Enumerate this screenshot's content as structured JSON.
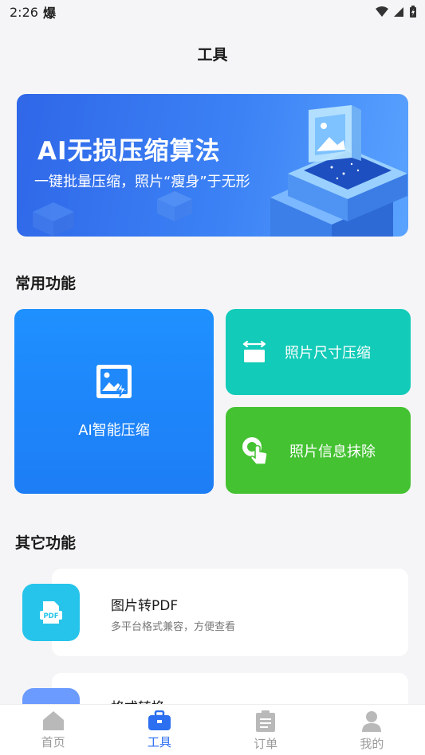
{
  "status": {
    "time": "2:26",
    "indicator": "爆"
  },
  "header": {
    "title": "工具"
  },
  "banner": {
    "title": "AI无损压缩算法",
    "subtitle": "一键批量压缩，照片“瘦身”于无形"
  },
  "sections": {
    "common": "常用功能",
    "other": "其它功能"
  },
  "cards": {
    "ai": {
      "label": "AI智能压缩",
      "icon": "image-bolt-icon",
      "color": "#1f8bff"
    },
    "resize": {
      "label": "照片尺寸压缩",
      "icon": "resize-icon",
      "color": "#12cbb8"
    },
    "erase": {
      "label": "照片信息抹除",
      "icon": "touch-erase-icon",
      "color": "#44c232"
    }
  },
  "list": [
    {
      "title": "图片转PDF",
      "desc": "多平台格式兼容，方便查看",
      "icon": "pdf-icon",
      "color": "#26c4ea"
    },
    {
      "title": "格式转换",
      "desc": "",
      "icon": "convert-icon",
      "color": "#6c9bff"
    }
  ],
  "tabs": [
    {
      "label": "首页",
      "icon": "home-icon"
    },
    {
      "label": "工具",
      "icon": "toolbox-icon"
    },
    {
      "label": "订单",
      "icon": "clipboard-icon"
    },
    {
      "label": "我的",
      "icon": "user-icon"
    }
  ],
  "colors": {
    "accent": "#2c6ff0",
    "tab_inactive": "#9a9a9a"
  }
}
